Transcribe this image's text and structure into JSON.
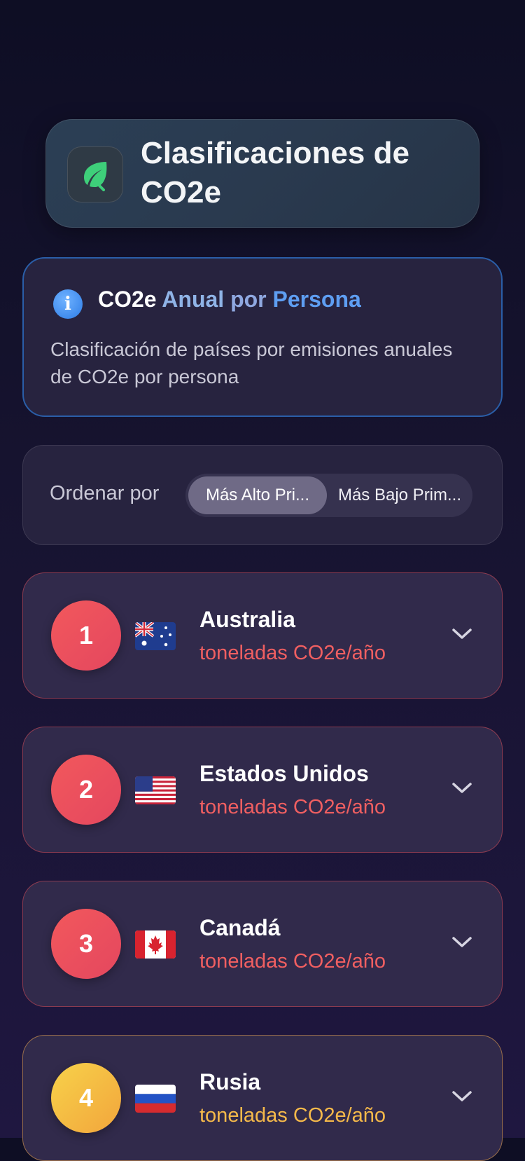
{
  "header": {
    "title": "Clasificaciones de CO2e",
    "icon": "leaf-icon"
  },
  "info": {
    "title_words": [
      "CO2e",
      "Anual",
      "por",
      "Persona"
    ],
    "description": "Clasificación de países por emisiones anuales de CO2e por persona",
    "icon": "info-icon"
  },
  "sort": {
    "label": "Ordenar por",
    "options": [
      "Más Alto Pri...",
      "Más Bajo Prim..."
    ],
    "selected": "Más Alto Pri..."
  },
  "rankings": [
    {
      "rank": "1",
      "country": "Australia",
      "unit": "toneladas CO2e/año",
      "flag": "australia-flag-icon",
      "accent": "#f05f61"
    },
    {
      "rank": "2",
      "country": "Estados Unidos",
      "unit": "toneladas CO2e/año",
      "flag": "usa-flag-icon",
      "accent": "#f05f61"
    },
    {
      "rank": "3",
      "country": "Canadá",
      "unit": "toneladas CO2e/año",
      "flag": "canada-flag-icon",
      "accent": "#f05f61"
    },
    {
      "rank": "4",
      "country": "Rusia",
      "unit": "toneladas CO2e/año",
      "flag": "russia-flag-icon",
      "accent": "#f5b94a"
    }
  ],
  "colors": {
    "background": "#16132f",
    "card": "#312a4b",
    "info_border": "#2a5ea8",
    "leaf": "#3ecf7a"
  }
}
